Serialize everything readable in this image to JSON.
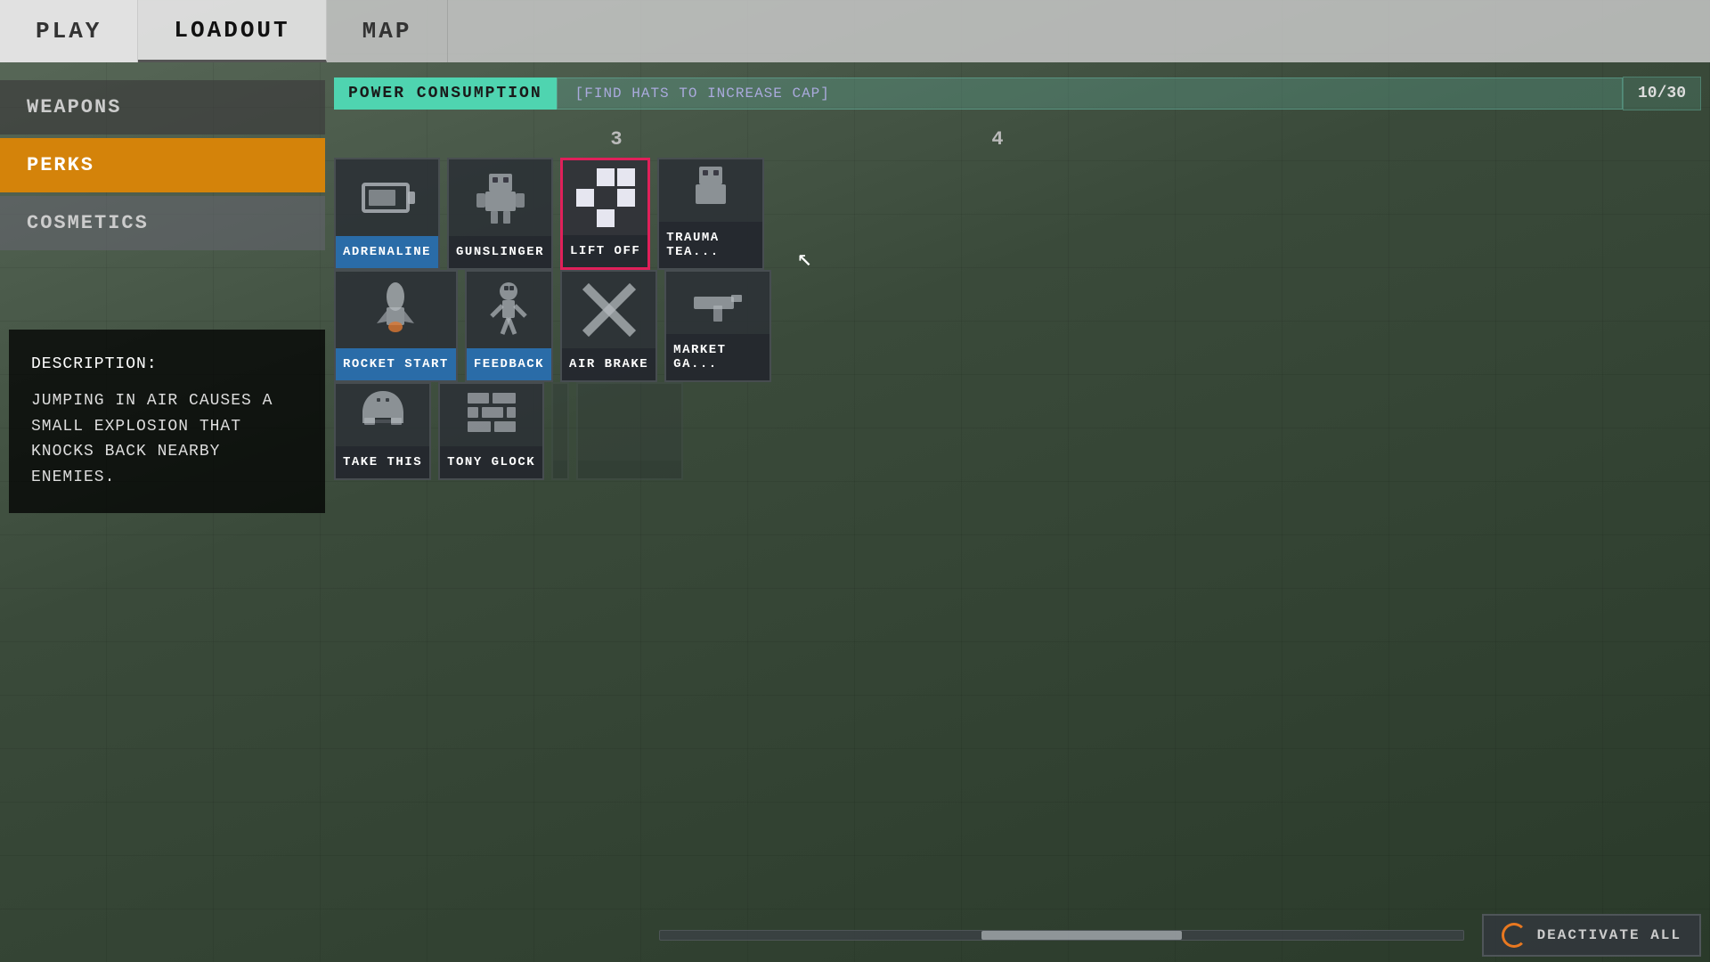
{
  "nav": {
    "items": [
      {
        "label": "PLAY",
        "active": false
      },
      {
        "label": "LOADOUT",
        "active": true
      },
      {
        "label": "MAP",
        "active": false
      }
    ]
  },
  "sidebar": {
    "items": [
      {
        "id": "weapons",
        "label": "WEAPONS",
        "active": false
      },
      {
        "id": "perks",
        "label": "PERKS",
        "active": true
      },
      {
        "id": "cosmetics",
        "label": "COSMETICS",
        "active": false
      }
    ]
  },
  "description": {
    "title": "DESCRIPTION:",
    "text": "JUMPING IN AIR CAUSES A SMALL EXPLOSION THAT KNOCKS BACK NEARBY ENEMIES."
  },
  "power": {
    "label": "POWER CONSUMPTION",
    "hint": "[FIND HATS TO INCREASE CAP]",
    "value": "10/30"
  },
  "grid": {
    "col3_label": "3",
    "col4_label": "4",
    "rows": [
      {
        "cards": [
          {
            "id": "adrenaline",
            "label": "ADRENALINE",
            "active": true,
            "selected": false,
            "icon": "battery"
          },
          {
            "id": "gunslinger",
            "label": "GUNSLINGER",
            "active": false,
            "selected": false,
            "icon": "robot"
          },
          {
            "id": "lift-off",
            "label": "LIFT OFF",
            "active": false,
            "selected": true,
            "icon": "liftoff"
          },
          {
            "id": "trauma-team",
            "label": "TRAUMA TEA...",
            "active": false,
            "selected": false,
            "icon": "robot2"
          }
        ]
      },
      {
        "cards": [
          {
            "id": "rocket-start",
            "label": "ROCKET START",
            "active": true,
            "selected": false,
            "icon": "rocket"
          },
          {
            "id": "feedback",
            "label": "FEEDBACK",
            "active": true,
            "selected": false,
            "icon": "skeleton"
          },
          {
            "id": "air-brake",
            "label": "AIR BRAKE",
            "active": false,
            "selected": false,
            "icon": "cross"
          },
          {
            "id": "market-ga",
            "label": "MARKET GA...",
            "active": false,
            "selected": false,
            "icon": "gun"
          }
        ]
      },
      {
        "cards": [
          {
            "id": "take-this",
            "label": "TAKE THIS",
            "active": false,
            "selected": false,
            "icon": "helmet"
          },
          {
            "id": "tony-glock",
            "label": "TONY GLOCK",
            "active": false,
            "selected": false,
            "icon": "wall"
          },
          {
            "id": "empty1",
            "label": "",
            "active": false,
            "selected": false,
            "icon": "empty"
          },
          {
            "id": "empty2",
            "label": "",
            "active": false,
            "selected": false,
            "icon": "empty"
          }
        ]
      }
    ]
  },
  "bottom": {
    "deactivate_label": "DEACTIVATE ALL"
  }
}
